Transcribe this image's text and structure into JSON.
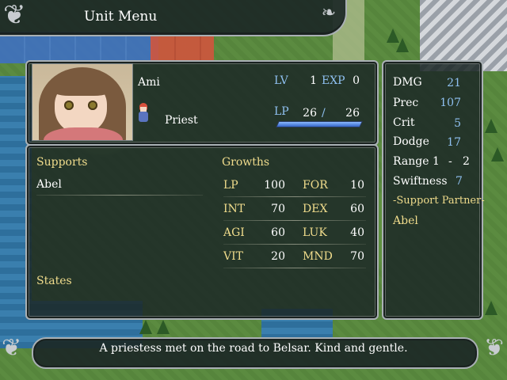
{
  "menu": {
    "title": "Unit Menu"
  },
  "unit": {
    "name": "Ami",
    "class": "Priest",
    "lv_label": "LV",
    "lv": "1",
    "exp_label": "EXP",
    "exp": "0",
    "lp_label": "LP",
    "lp_current": "26",
    "lp_sep": "/",
    "lp_max": "26",
    "lp_fraction": 1.0
  },
  "supports": {
    "label": "Supports",
    "items": [
      "Abel"
    ]
  },
  "states": {
    "label": "States"
  },
  "growths": {
    "label": "Growths",
    "rows": [
      {
        "a_label": "LP",
        "a_value": "100",
        "b_label": "FOR",
        "b_value": "10"
      },
      {
        "a_label": "INT",
        "a_value": "70",
        "b_label": "DEX",
        "b_value": "60"
      },
      {
        "a_label": "AGI",
        "a_value": "60",
        "b_label": "LUK",
        "b_value": "40"
      },
      {
        "a_label": "VIT",
        "a_value": "20",
        "b_label": "MND",
        "b_value": "70"
      }
    ]
  },
  "combat": {
    "dmg_label": "DMG",
    "dmg": "21",
    "prec_label": "Prec",
    "prec": "107",
    "crit_label": "Crit",
    "crit": "5",
    "dodge_label": "Dodge",
    "dodge": "17",
    "range_label": "Range",
    "range_min": "1",
    "range_sep": "-",
    "range_max": "2",
    "swiftness_label": "Swiftness",
    "swiftness": "7",
    "support_partner_label": "-Support Partner-",
    "support_partner": "Abel"
  },
  "description": "A priestess met on the road to Belsar. Kind and gentle.",
  "colors": {
    "label_gold": "#f0dc8c",
    "label_blue": "#8fc0f0",
    "panel_bg": "#1c2826"
  }
}
